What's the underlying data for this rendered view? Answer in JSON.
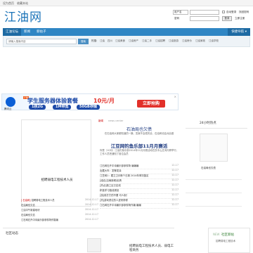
{
  "topbar": {
    "set_home": "设为首页",
    "bookmark": "收藏本站"
  },
  "logo": "江油网",
  "login": {
    "account_type": "用户名",
    "username_label": "",
    "password_label": "密码",
    "auto_login": "自动登录",
    "retrieve_password": "找回密码",
    "login_button": "登录",
    "register_button": "立即注册"
  },
  "nav": {
    "items": [
      {
        "label": "江油论坛",
        "active": true
      },
      {
        "label": "新闻",
        "active": false
      },
      {
        "label": "新帖子",
        "active": false
      }
    ],
    "quick": "快捷导航"
  },
  "search": {
    "placeholder": "请输入搜索内容",
    "button": "搜索",
    "hot_label": "热搜:",
    "hot": [
      "江油",
      "四川",
      "江油美食",
      "江油房产",
      "江油二手",
      "江油招聘",
      "江油旅游",
      "江油房价",
      "江油家政",
      "江油学校"
    ]
  },
  "ad": {
    "tag": "广告",
    "brand": "腾讯云",
    "headline": "学生服务器体验套餐",
    "price": "10元/月",
    "specs": [
      "1核2G",
      "1M带宽",
      "50GB存储"
    ],
    "buy": "立即抢购"
  },
  "feature": {
    "caption": "招聘弱电工程技术人员"
  },
  "small_news": [
    {
      "tag": "[ 石油网]",
      "title": "招聘弱电工程技术人员",
      "date": "2014-12-17"
    },
    {
      "tag": "",
      "title": "石油局也欠债",
      "date": "2014-12-17"
    },
    {
      "tag": "",
      "title": "江油中午新建地块",
      "date": "2014-12-17"
    },
    {
      "tag": "",
      "title": "石油局也欠债",
      "date": "2014-12-17"
    },
    {
      "tag": "",
      "title": "江石网石卉中诗最乐部参现场作摄编",
      "date": "2014-12-17"
    }
  ],
  "center": {
    "section_label": "新闻",
    "section_sub": "news center",
    "headline1": "石油局也欠债",
    "sub1": "在石油网大家都知道的一篇，答案不会很完全，石油网也会对此做",
    "headline2": "江豆网钓鱼乐部11月月赛活",
    "sub2": "你是（10月）江油钓鱼乐部2014年11月月赛活动在凯丰山庄鸿沟旁举行，工作人员把通知了各位会员",
    "list": [
      {
        "title": "江石网石卉中诗最乐部参现场 编编编",
        "date": "12-17"
      },
      {
        "title": "出藏大车：发警发涂",
        "date": "12-17"
      },
      {
        "title": "江豆网1：藏卫卫诊断个日报 2014年情况鉴定",
        "date": "12-17"
      },
      {
        "title": "[组合]当局新闻/民情",
        "date": "12-17"
      },
      {
        "title": "[热点]施工区已定线",
        "date": "12-17"
      },
      {
        "title": "积极学习路线规划",
        "date": "12-17"
      },
      {
        "title": "[游]真打打的不要 可人制！",
        "date": "12-17"
      },
      {
        "title": "[热]游戏资论的人进来修修",
        "date": "12-17"
      },
      {
        "title": "江石网石卉中诗最乐部参现场作编 编编",
        "date": "12-17"
      }
    ]
  },
  "right": {
    "title": "24小时热点",
    "caption": "石油局也欠债"
  },
  "community": {
    "label": "社区动态",
    "text": "招聘弱电工程技术人员、弱电工程商务"
  },
  "sideboard": {
    "badge": "NEW",
    "label": "社区新帖",
    "sub": "招聘弱电工程技术"
  }
}
